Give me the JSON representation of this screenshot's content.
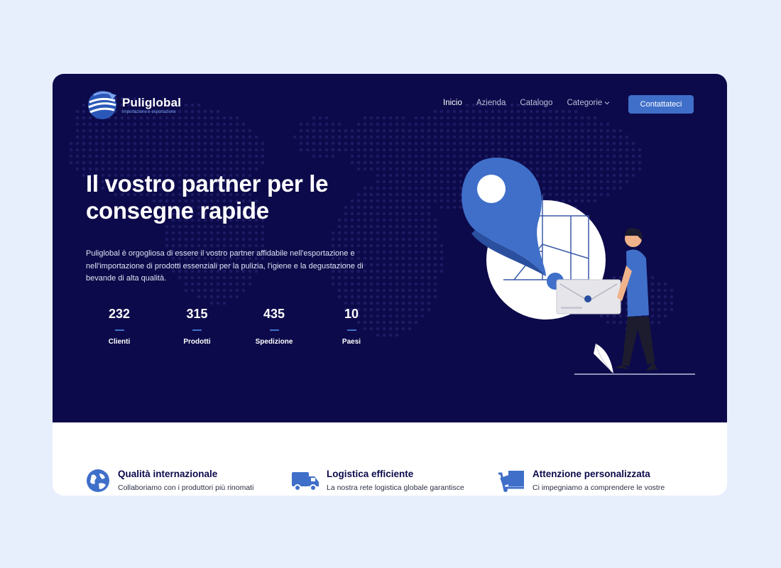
{
  "brand": {
    "name": "Puliglobal",
    "tagline": "Importazione e esportazione",
    "accent": "#3f6fc9",
    "navy": "#0c0a4a"
  },
  "nav": {
    "items": [
      {
        "label": "Inicio",
        "active": true
      },
      {
        "label": "Azienda",
        "active": false
      },
      {
        "label": "Catalogo",
        "active": false
      },
      {
        "label": "Categorie",
        "active": false,
        "has_dropdown": true
      }
    ],
    "cta": "Contattateci"
  },
  "hero": {
    "title": "Il vostro partner per le consegne rapide",
    "description": "Puliglobal è orgogliosa di essere il vostro partner affidabile nell'esportazione e nell'importazione di prodotti essenziali per la pulizia, l'igiene e la degustazione di bevande di alta qualità."
  },
  "stats": [
    {
      "value": "232",
      "label": "Clienti"
    },
    {
      "value": "315",
      "label": "Prodotti"
    },
    {
      "value": "435",
      "label": "Spedizione"
    },
    {
      "value": "10",
      "label": "Paesi"
    }
  ],
  "features": [
    {
      "icon": "globe-icon",
      "title": "Qualità internazionale",
      "text": "Collaboriamo con i produttori più rinomati"
    },
    {
      "icon": "truck-icon",
      "title": "Logistica efficiente",
      "text": "La nostra rete logistica globale garantisce"
    },
    {
      "icon": "hand-truck-icon",
      "title": "Attenzione personalizzata",
      "text": "Ci impegniamo a comprendere le vostre"
    }
  ]
}
